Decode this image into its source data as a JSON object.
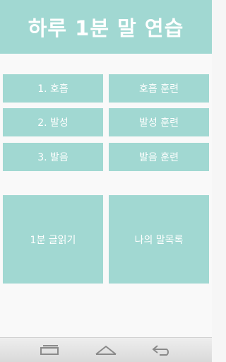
{
  "header": {
    "title": "하루 1분 말 연습"
  },
  "menu": {
    "rows": [
      {
        "left": "1. 호흡",
        "right": "호흡 훈련"
      },
      {
        "left": "2. 발성",
        "right": "발성 훈련"
      },
      {
        "left": "3. 발음",
        "right": "발음 훈련"
      }
    ],
    "big": {
      "left": "1분 글읽기",
      "right": "나의 말목록"
    }
  },
  "navbar": {
    "icons": [
      "recent-apps-icon",
      "home-icon",
      "back-icon"
    ]
  },
  "colors": {
    "accent": "#a1d8d2",
    "background": "#f9f9f9",
    "text_on_accent": "#ffffff"
  }
}
